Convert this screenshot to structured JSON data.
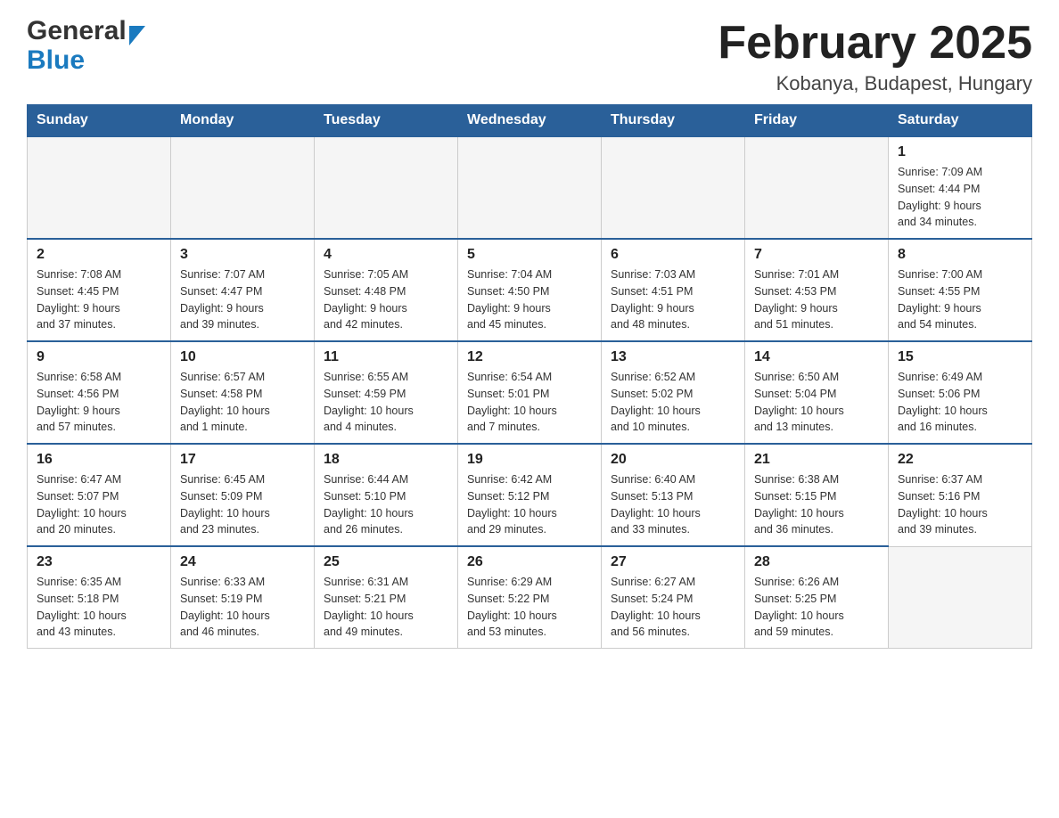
{
  "header": {
    "logo_general": "General",
    "logo_blue": "Blue",
    "month_title": "February 2025",
    "location": "Kobanya, Budapest, Hungary"
  },
  "weekdays": [
    "Sunday",
    "Monday",
    "Tuesday",
    "Wednesday",
    "Thursday",
    "Friday",
    "Saturday"
  ],
  "weeks": [
    [
      {
        "day": "",
        "info": ""
      },
      {
        "day": "",
        "info": ""
      },
      {
        "day": "",
        "info": ""
      },
      {
        "day": "",
        "info": ""
      },
      {
        "day": "",
        "info": ""
      },
      {
        "day": "",
        "info": ""
      },
      {
        "day": "1",
        "info": "Sunrise: 7:09 AM\nSunset: 4:44 PM\nDaylight: 9 hours\nand 34 minutes."
      }
    ],
    [
      {
        "day": "2",
        "info": "Sunrise: 7:08 AM\nSunset: 4:45 PM\nDaylight: 9 hours\nand 37 minutes."
      },
      {
        "day": "3",
        "info": "Sunrise: 7:07 AM\nSunset: 4:47 PM\nDaylight: 9 hours\nand 39 minutes."
      },
      {
        "day": "4",
        "info": "Sunrise: 7:05 AM\nSunset: 4:48 PM\nDaylight: 9 hours\nand 42 minutes."
      },
      {
        "day": "5",
        "info": "Sunrise: 7:04 AM\nSunset: 4:50 PM\nDaylight: 9 hours\nand 45 minutes."
      },
      {
        "day": "6",
        "info": "Sunrise: 7:03 AM\nSunset: 4:51 PM\nDaylight: 9 hours\nand 48 minutes."
      },
      {
        "day": "7",
        "info": "Sunrise: 7:01 AM\nSunset: 4:53 PM\nDaylight: 9 hours\nand 51 minutes."
      },
      {
        "day": "8",
        "info": "Sunrise: 7:00 AM\nSunset: 4:55 PM\nDaylight: 9 hours\nand 54 minutes."
      }
    ],
    [
      {
        "day": "9",
        "info": "Sunrise: 6:58 AM\nSunset: 4:56 PM\nDaylight: 9 hours\nand 57 minutes."
      },
      {
        "day": "10",
        "info": "Sunrise: 6:57 AM\nSunset: 4:58 PM\nDaylight: 10 hours\nand 1 minute."
      },
      {
        "day": "11",
        "info": "Sunrise: 6:55 AM\nSunset: 4:59 PM\nDaylight: 10 hours\nand 4 minutes."
      },
      {
        "day": "12",
        "info": "Sunrise: 6:54 AM\nSunset: 5:01 PM\nDaylight: 10 hours\nand 7 minutes."
      },
      {
        "day": "13",
        "info": "Sunrise: 6:52 AM\nSunset: 5:02 PM\nDaylight: 10 hours\nand 10 minutes."
      },
      {
        "day": "14",
        "info": "Sunrise: 6:50 AM\nSunset: 5:04 PM\nDaylight: 10 hours\nand 13 minutes."
      },
      {
        "day": "15",
        "info": "Sunrise: 6:49 AM\nSunset: 5:06 PM\nDaylight: 10 hours\nand 16 minutes."
      }
    ],
    [
      {
        "day": "16",
        "info": "Sunrise: 6:47 AM\nSunset: 5:07 PM\nDaylight: 10 hours\nand 20 minutes."
      },
      {
        "day": "17",
        "info": "Sunrise: 6:45 AM\nSunset: 5:09 PM\nDaylight: 10 hours\nand 23 minutes."
      },
      {
        "day": "18",
        "info": "Sunrise: 6:44 AM\nSunset: 5:10 PM\nDaylight: 10 hours\nand 26 minutes."
      },
      {
        "day": "19",
        "info": "Sunrise: 6:42 AM\nSunset: 5:12 PM\nDaylight: 10 hours\nand 29 minutes."
      },
      {
        "day": "20",
        "info": "Sunrise: 6:40 AM\nSunset: 5:13 PM\nDaylight: 10 hours\nand 33 minutes."
      },
      {
        "day": "21",
        "info": "Sunrise: 6:38 AM\nSunset: 5:15 PM\nDaylight: 10 hours\nand 36 minutes."
      },
      {
        "day": "22",
        "info": "Sunrise: 6:37 AM\nSunset: 5:16 PM\nDaylight: 10 hours\nand 39 minutes."
      }
    ],
    [
      {
        "day": "23",
        "info": "Sunrise: 6:35 AM\nSunset: 5:18 PM\nDaylight: 10 hours\nand 43 minutes."
      },
      {
        "day": "24",
        "info": "Sunrise: 6:33 AM\nSunset: 5:19 PM\nDaylight: 10 hours\nand 46 minutes."
      },
      {
        "day": "25",
        "info": "Sunrise: 6:31 AM\nSunset: 5:21 PM\nDaylight: 10 hours\nand 49 minutes."
      },
      {
        "day": "26",
        "info": "Sunrise: 6:29 AM\nSunset: 5:22 PM\nDaylight: 10 hours\nand 53 minutes."
      },
      {
        "day": "27",
        "info": "Sunrise: 6:27 AM\nSunset: 5:24 PM\nDaylight: 10 hours\nand 56 minutes."
      },
      {
        "day": "28",
        "info": "Sunrise: 6:26 AM\nSunset: 5:25 PM\nDaylight: 10 hours\nand 59 minutes."
      },
      {
        "day": "",
        "info": ""
      }
    ]
  ]
}
